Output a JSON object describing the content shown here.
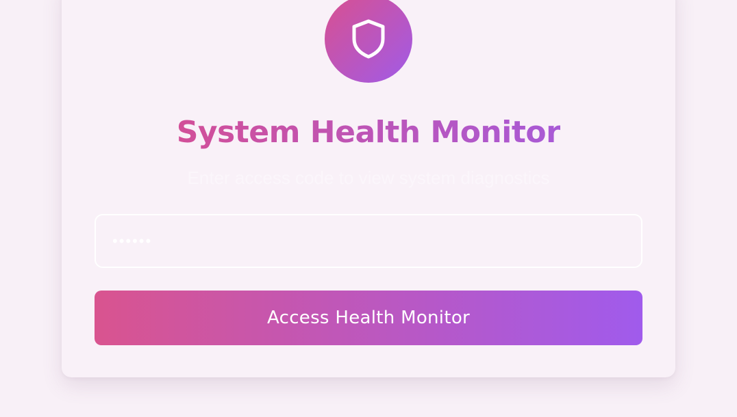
{
  "app": {
    "title": "System Health Monitor",
    "subtitle": "Enter access code to view system diagnostics"
  },
  "logo": {
    "icon": "shield-icon"
  },
  "form": {
    "access_code_value": "••••••",
    "submit_label": "Access Health Monitor"
  },
  "colors": {
    "background": "#f8f0f7",
    "card": "#f9f1f8",
    "gradient_start": "#d9548f",
    "gradient_end": "#a05bec"
  }
}
